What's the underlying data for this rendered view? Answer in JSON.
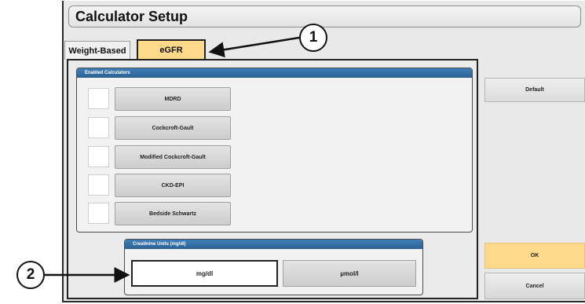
{
  "window": {
    "title": "Calculator Setup"
  },
  "tabs": [
    {
      "label": "Weight-Based",
      "active": false
    },
    {
      "label": "eGFR",
      "active": true
    }
  ],
  "calculators_panel": {
    "header": "Enabled Calculators",
    "items": [
      {
        "label": "MDRD",
        "checked": false
      },
      {
        "label": "Cockcroft-Gault",
        "checked": false
      },
      {
        "label": "Modified Cockcroft-Gault",
        "checked": false
      },
      {
        "label": "CKD-EPI",
        "checked": false
      },
      {
        "label": "Bedside Schwartz",
        "checked": false
      }
    ]
  },
  "units_panel": {
    "header": "Creatinine Units   (mg/dl)",
    "options": [
      {
        "label": "mg/dl",
        "selected": true
      },
      {
        "label": "µmol/l",
        "selected": false
      }
    ]
  },
  "side_buttons": {
    "default": "Default",
    "ok": "OK",
    "cancel": "Cancel"
  },
  "callouts": {
    "one": "1",
    "two": "2"
  },
  "colors": {
    "accent": "#ffd98a",
    "header_blue": "#2f6ca5"
  }
}
